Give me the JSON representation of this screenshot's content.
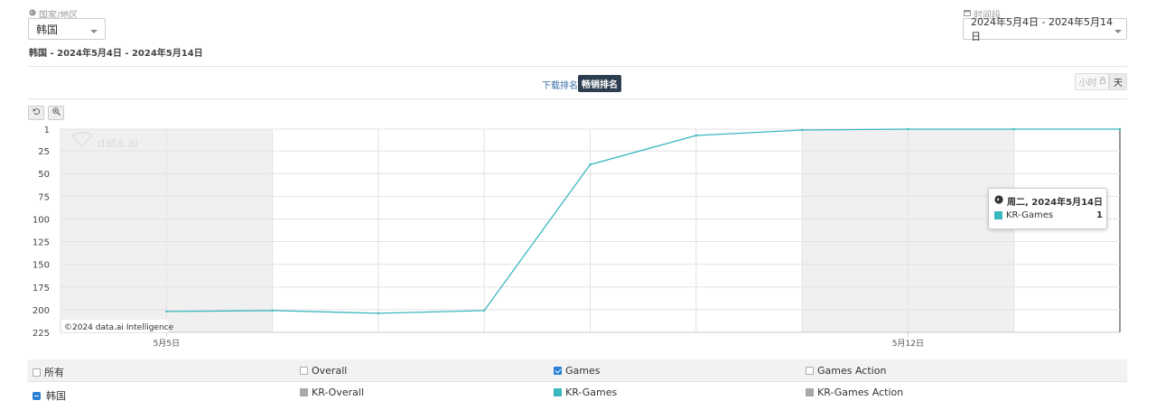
{
  "filters": {
    "country_label": "国家/地区",
    "country_value": "韩国",
    "period_label": "时间段",
    "period_value": "2024年5月4日 - 2024年5月14日",
    "subtitle": "韩国 - 2024年5月4日 - 2024年5月14日"
  },
  "rank_tabs": {
    "download": "下载排名",
    "revenue": "畅销排名",
    "active": "revenue"
  },
  "granularity": {
    "hour": "小时",
    "day": "天",
    "active": "day"
  },
  "chart_data": {
    "type": "line",
    "x": [
      "2024-05-04",
      "2024-05-05",
      "2024-05-06",
      "2024-05-07",
      "2024-05-08",
      "2024-05-09",
      "2024-05-10",
      "2024-05-11",
      "2024-05-12",
      "2024-05-13",
      "2024-05-14"
    ],
    "series": [
      {
        "name": "KR-Games",
        "color": "#3ab7bf",
        "values": [
          null,
          202,
          201,
          204,
          201,
          40,
          8,
          2,
          1,
          1,
          1
        ]
      }
    ],
    "y_ticks": [
      1,
      25,
      50,
      75,
      100,
      125,
      150,
      175,
      200,
      225
    ],
    "ylim": [
      1,
      225
    ],
    "y_reversed": true,
    "x_tick_labels": [
      {
        "x": "2024-05-05",
        "label": "5月5日"
      },
      {
        "x": "2024-05-12",
        "label": "5月12日"
      }
    ],
    "weekend_bands": [
      [
        "2024-05-04",
        "2024-05-05"
      ],
      [
        "2024-05-11",
        "2024-05-12"
      ]
    ],
    "watermark": "data.ai",
    "credit": "©2024 data.ai Intelligence",
    "tooltip": {
      "date": "周二, 2024年5月14日",
      "series": "KR-Games",
      "value": "1"
    }
  },
  "legend": {
    "header": [
      "所有",
      "Overall",
      "Games",
      "Games Action"
    ],
    "header_checked": [
      false,
      false,
      true,
      false
    ],
    "country": "韩国",
    "series": [
      {
        "label": "KR-Overall",
        "color": "#a8a8a8"
      },
      {
        "label": "KR-Games",
        "color": "#3ab7bf"
      },
      {
        "label": "KR-Games Action",
        "color": "#a8a8a8"
      }
    ]
  }
}
